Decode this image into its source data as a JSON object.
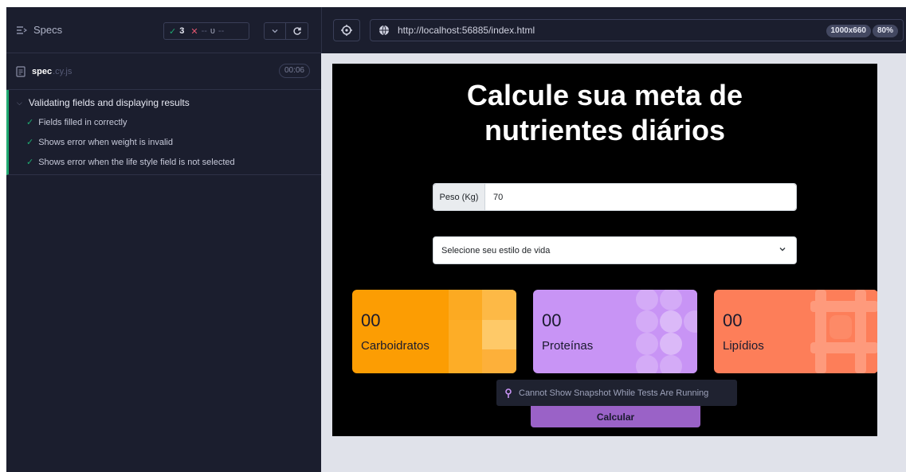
{
  "reporter": {
    "specs_label": "Specs",
    "stats": {
      "passed": "3",
      "failed_dash": "--",
      "pending_dash": "--"
    },
    "spec": {
      "name": "spec",
      "ext": ".cy.js",
      "duration": "00:06"
    },
    "suite": {
      "title": "Validating fields and displaying results",
      "tests": [
        "Fields filled in correctly",
        "Shows error when weight is invalid",
        "Shows error when the life style field is not selected"
      ]
    }
  },
  "browser": {
    "url": "http://localhost:56885/index.html",
    "viewport": "1000x660",
    "zoom": "80%"
  },
  "app": {
    "title_line1": "Calcule sua meta de",
    "title_line2": "nutrientes diários",
    "weight_label": "Peso (Kg)",
    "weight_value": "70",
    "lifestyle_placeholder": "Selecione seu estilo de vida",
    "cards": [
      {
        "value": "00",
        "label": "Carboidratos",
        "color": "#fc9d03"
      },
      {
        "value": "00",
        "label": "Proteínas",
        "color": "#c894f5"
      },
      {
        "value": "00",
        "label": "Lipídios",
        "color": "#fd7e59"
      }
    ],
    "snapshot_message": "Cannot Show Snapshot While Tests Are Running",
    "calculate_label": "Calcular"
  },
  "colors": {
    "panel_bg": "#1b1e2e",
    "pass_green": "#1fa971",
    "fail_red": "#e45770"
  }
}
